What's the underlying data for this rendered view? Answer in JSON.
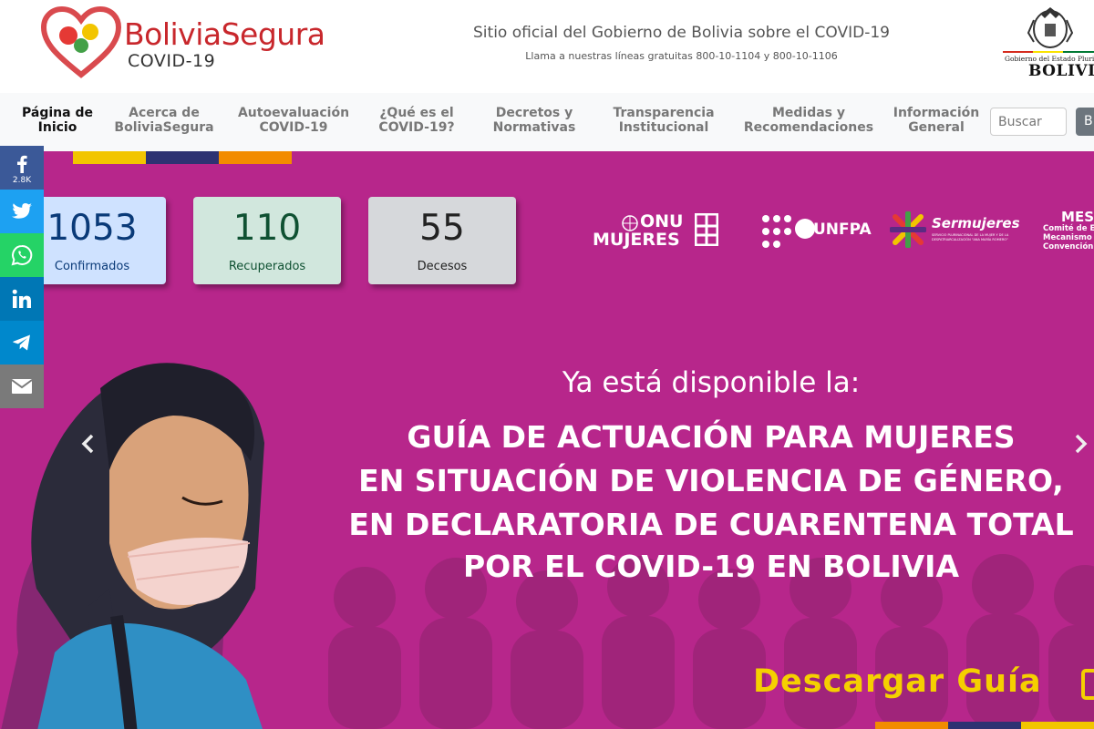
{
  "header": {
    "brand_title": "BoliviaSegura",
    "brand_subtitle": "COVID-19",
    "tagline": "Sitio oficial del Gobierno de Bolivia sobre el COVID-19",
    "phones": "Llama a nuestras líneas gratuitas 800-10-1104 y 800-10-1106",
    "gov_small": "Gobierno del Estado Plurinacional de",
    "gov_big": "BOLIVIA"
  },
  "nav": {
    "items": [
      {
        "line1": "Página de",
        "line2": "Inicio",
        "active": true
      },
      {
        "line1": "Acerca de",
        "line2": "BoliviaSegura"
      },
      {
        "line1": "Autoevaluación",
        "line2": "COVID-19"
      },
      {
        "line1": "¿Qué es el",
        "line2": "COVID-19?"
      },
      {
        "line1": "Decretos y",
        "line2": "Normativas"
      },
      {
        "line1": "Transparencia",
        "line2": "Institucional"
      },
      {
        "line1": "Medidas y",
        "line2": "Recomendaciones"
      },
      {
        "line1": "Información",
        "line2": "General"
      }
    ],
    "search_placeholder": "Buscar",
    "search_button": "B"
  },
  "stats": [
    {
      "value": "1053",
      "label": "Confirmados",
      "bg": "#cfe2ff",
      "fg": "#0a3a78"
    },
    {
      "value": "110",
      "label": "Recuperados",
      "bg": "#d1e7dd",
      "fg": "#0f5132"
    },
    {
      "value": "55",
      "label": "Decesos",
      "bg": "#d6d8db",
      "fg": "#222222"
    }
  ],
  "partners": {
    "onu_line1": "ONU",
    "onu_line2": "MUJERES",
    "unfpa": "UNFPA",
    "sermujeres": "Sermujeres",
    "sermujeres_sub": "SERVICIO PLURINACIONAL DE LA MUJER Y DE LA DESPATRIARCALIZACIÓN \"ANA MARÍA ROMERO\"",
    "mesecvi_line1": "MES",
    "mesecvi_line2": "Comité de E",
    "mesecvi_line3": "Mecanismo de S",
    "mesecvi_line4": "Convención B"
  },
  "social": {
    "facebook_count": "2.8K"
  },
  "hero": {
    "lead": "Ya está disponible la:",
    "title_lines": [
      "GUÍA DE ACTUACIÓN PARA MUJERES",
      "EN SITUACIÓN DE VIOLENCIA DE GÉNERO,",
      "EN DECLARATORIA DE CUARENTENA TOTAL",
      "POR  EL COVID-19 EN BOLIVIA"
    ],
    "download": "Descargar Guía"
  },
  "colors": {
    "hero_bg": "#b7268b",
    "brand_red": "#c8272c",
    "flag_yellow": "#f2c500",
    "flag_navy": "#2d3272",
    "flag_orange": "#f28c00",
    "download_yellow": "#f5d000"
  },
  "icons": [
    "facebook-icon",
    "twitter-icon",
    "whatsapp-icon",
    "linkedin-icon",
    "telegram-icon",
    "email-icon",
    "chevron-left-icon",
    "chevron-right-icon"
  ]
}
